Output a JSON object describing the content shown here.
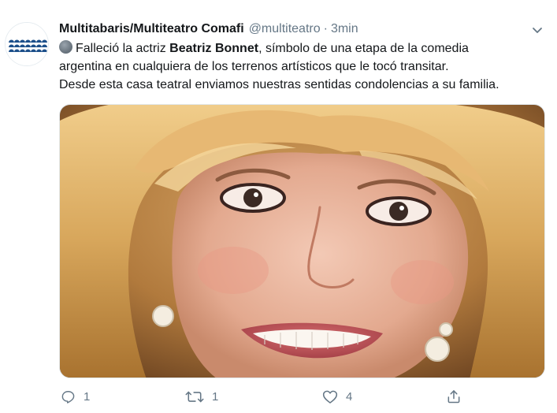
{
  "tweet": {
    "display_name": "Multitabaris/Multiteatro Comafi",
    "handle": "@multiteatro",
    "separator": "·",
    "time": "3min",
    "text_lines": {
      "l1_pre": "Falleció la actriz ",
      "l1_bold": "Beatriz Bonnet",
      "l1_post": ", símbolo de una etapa de la comedia",
      "l2": "argentina en cualquiera de los terrenos artísticos que le tocó transitar.",
      "l3": "Desde esta casa teatral enviamos nuestras sentidas condolencias a su familia."
    },
    "emoji": "gray-circle-emoji",
    "media": {
      "kind": "photo"
    },
    "actions": {
      "reply_count": "1",
      "retweet_count": "1",
      "like_count": "4",
      "share_count": ""
    }
  },
  "icons": {
    "reply": "reply-icon",
    "retweet": "retweet-icon",
    "like": "heart-icon",
    "share": "share-icon",
    "caret": "chevron-down-icon"
  },
  "colors": {
    "text": "#14171a",
    "secondary": "#657786",
    "logo_blue": "#1c4f8a",
    "border": "#e1e8ed"
  }
}
